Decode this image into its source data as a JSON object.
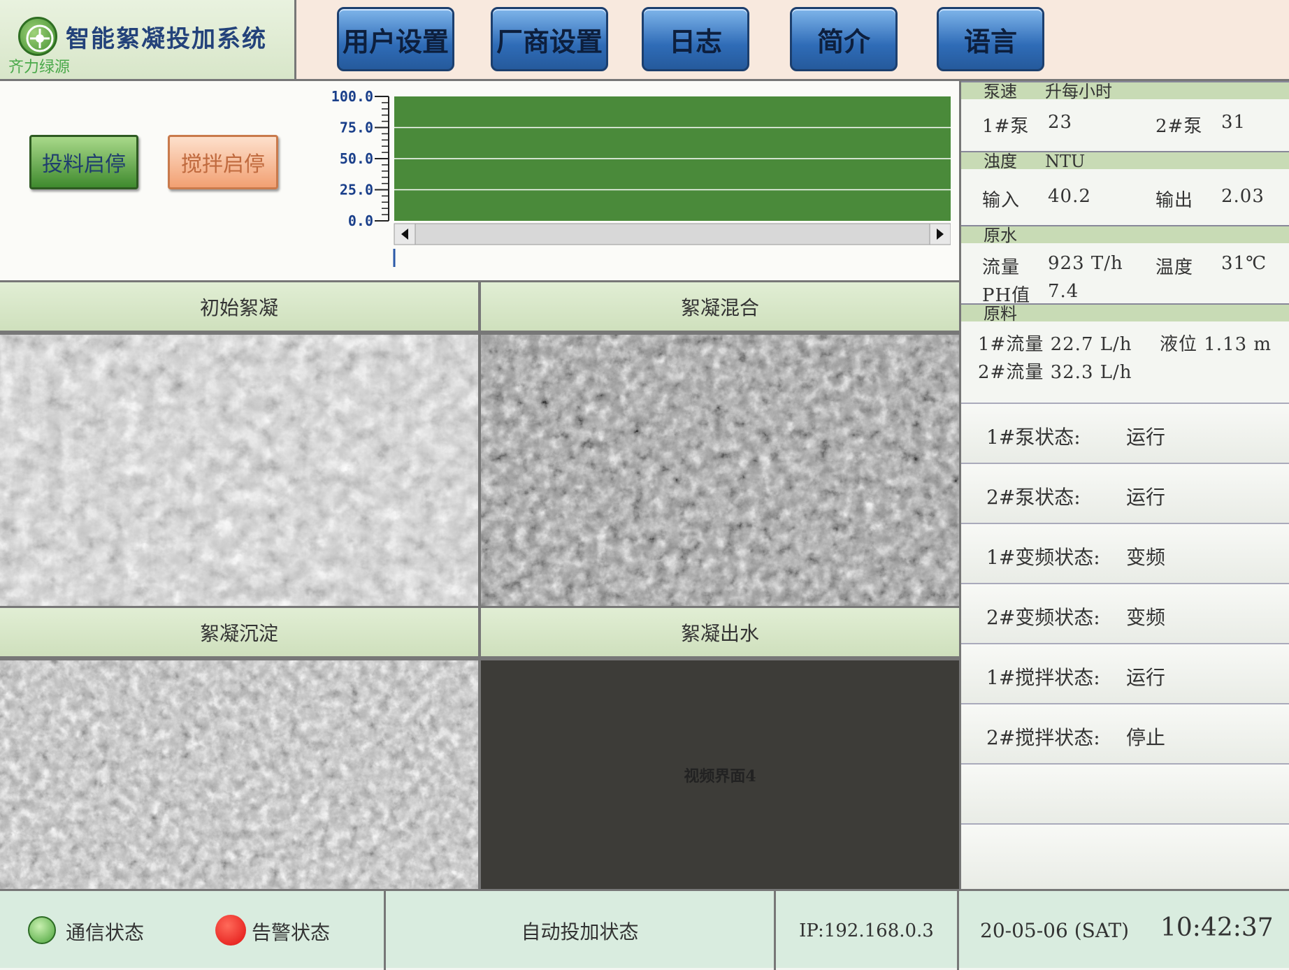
{
  "header": {
    "app_title": "智能絮凝投加系统",
    "brand": "齐力绿源",
    "nav": [
      "用户设置",
      "厂商设置",
      "日志",
      "简介",
      "语言"
    ]
  },
  "controls": {
    "feed_button": "投料启停",
    "mix_button": "搅拌启停"
  },
  "chart_data": {
    "type": "area",
    "y_ticks": [
      "100.0",
      "75.0",
      "50.0",
      "25.0",
      "0.0"
    ],
    "ylim": [
      0,
      100
    ],
    "values": [
      100,
      100
    ],
    "fill_color": "#4a8a3a"
  },
  "right": {
    "pump": {
      "title": "泵速",
      "unit": "升每小时",
      "p1_label": "1#泵",
      "p1_value": "23",
      "p2_label": "2#泵",
      "p2_value": "31"
    },
    "turbidity": {
      "title": "浊度",
      "unit": "NTU",
      "in_label": "输入",
      "in_value": "40.2",
      "out_label": "输出",
      "out_value": "2.03"
    },
    "raw_water": {
      "title": "原水",
      "flow_label": "流量",
      "flow_value": "923 T/h",
      "temp_label": "温度",
      "temp_value": "31℃",
      "ph_label": "PH值",
      "ph_value": "7.4"
    },
    "material": {
      "title": "原料",
      "flow1": "1#流量 22.7 L/h",
      "level": "液位 1.13 m",
      "flow2": "2#流量 32.3 L/h"
    },
    "statuses": [
      {
        "label": "1#泵状态:",
        "value": "运行"
      },
      {
        "label": "2#泵状态:",
        "value": "运行"
      },
      {
        "label": "1#变频状态:",
        "value": "变频"
      },
      {
        "label": "2#变频状态:",
        "value": "变频"
      },
      {
        "label": "1#搅拌状态:",
        "value": "运行"
      },
      {
        "label": "2#搅拌状态:",
        "value": "停止"
      }
    ]
  },
  "videos": [
    {
      "title": "初始絮凝"
    },
    {
      "title": "絮凝混合"
    },
    {
      "title": "絮凝沉淀"
    },
    {
      "title": "絮凝出水",
      "placeholder": "视频界面4"
    }
  ],
  "status_bar": {
    "comm": "通信状态",
    "alarm": "告警状态",
    "auto": "自动投加状态",
    "ip": "IP:192.168.0.3",
    "date": "20-05-06 (SAT)",
    "time": "10:42:37"
  }
}
